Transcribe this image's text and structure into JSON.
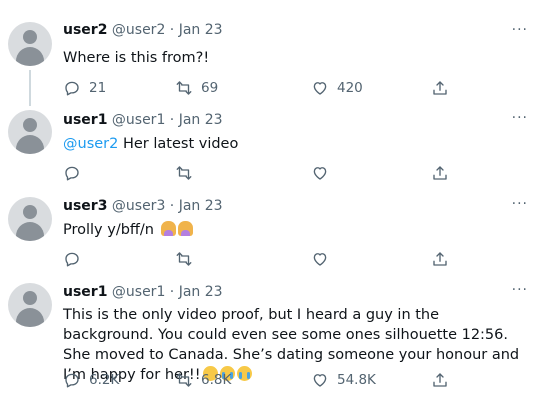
{
  "tweets": [
    {
      "name": "user2",
      "meta": "@user2 · Jan 23",
      "text": "Where is this from?!",
      "reply_count": "21",
      "retweet_count": "69",
      "like_count": "420"
    },
    {
      "name": "user1",
      "meta": "@user1 · Jan 23",
      "mention": "@user2",
      "text": " Her latest video",
      "reply_count": "",
      "retweet_count": "",
      "like_count": ""
    },
    {
      "name": "user3",
      "meta": "@user3 · Jan 23",
      "text": "Prolly y/bff/n",
      "emojis": [
        "woman-facepalming-emoji",
        "woman-facepalming-emoji"
      ],
      "reply_count": "",
      "retweet_count": "",
      "like_count": ""
    },
    {
      "name": "user1",
      "meta": "@user1 · Jan 23",
      "text": "This is the only video proof, but I heard a guy in the background. You could even see some ones silhouette 12:56. She moved to Canada. She’s dating someone your honour and I’m happy for her!!",
      "emojis": [
        "pleading-face-emoji",
        "crying-face-emoji",
        "crying-face-emoji"
      ],
      "reply_count": "6.2K",
      "retweet_count": "6.8K",
      "like_count": "54.8K"
    }
  ],
  "more_label": "···",
  "icons": {
    "reply": "reply-icon",
    "retweet": "retweet-icon",
    "like": "heart-icon",
    "share": "share-icon",
    "more": "more-options-icon"
  },
  "colors": {
    "text": "#0f1419",
    "secondary": "#536471",
    "mention": "#1d9bf0",
    "thread_line": "#cfd9de"
  }
}
